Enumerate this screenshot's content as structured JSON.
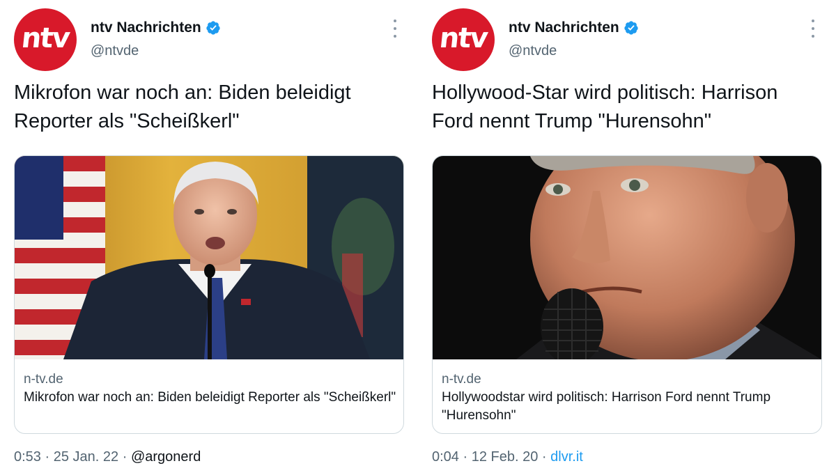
{
  "tweets": [
    {
      "display_name": "ntv Nachrichten",
      "handle": "@ntvde",
      "avatar_text": "ntv",
      "verified_icon": "verified-badge-icon",
      "text": "Mikrofon war noch an: Biden beleidigt Reporter als \"Scheißkerl\"",
      "card": {
        "domain": "n-tv.de",
        "title": "Mikrofon war noch an: Biden beleidigt Reporter als \"Scheißkerl\""
      },
      "time": "0:53",
      "date": "25 Jan. 22",
      "separator": "·",
      "source": "@argonerd"
    },
    {
      "display_name": "ntv Nachrichten",
      "handle": "@ntvde",
      "avatar_text": "ntv",
      "verified_icon": "verified-badge-icon",
      "text": "Hollywood-Star wird politisch: Harrison Ford nennt Trump \"Hurensohn\"",
      "card": {
        "domain": "n-tv.de",
        "title": "Hollywoodstar wird politisch: Harrison Ford nennt Trump \"Hurensohn\""
      },
      "time": "0:04",
      "date": "12 Feb. 20",
      "separator": "·",
      "source": "dlvr.it"
    }
  ],
  "colors": {
    "brand_red": "#d8192a",
    "verified_blue": "#1d9bf0",
    "secondary_text": "#536471",
    "border": "#cfd9de"
  }
}
